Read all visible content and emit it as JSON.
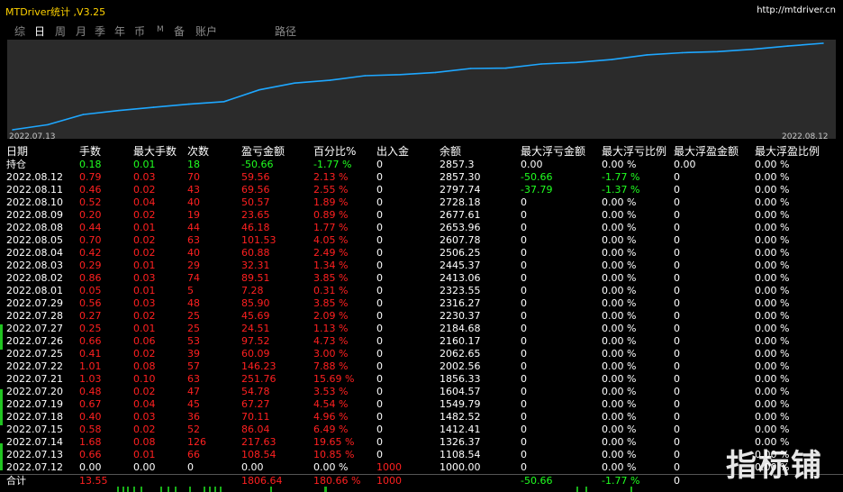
{
  "window": {
    "title": "MTDriver统计 ,V3.25",
    "url": "http://mtdriver.cn"
  },
  "tabs": [
    {
      "label": "综",
      "active": false
    },
    {
      "label": "日",
      "active": true
    },
    {
      "label": "周",
      "active": false
    },
    {
      "label": "月",
      "active": false
    },
    {
      "label": "季",
      "active": false
    },
    {
      "label": "年",
      "active": false
    },
    {
      "label": "币",
      "active": false
    },
    {
      "label": "M",
      "active": false
    },
    {
      "label": "备",
      "active": false
    },
    {
      "label": "账户",
      "active": false
    },
    {
      "label": "路径",
      "active": false
    }
  ],
  "chart_data": {
    "type": "line",
    "x_start_label": "2022.07.13",
    "x_end_label": "2022.08.12",
    "x": [
      "2022.07.12",
      "2022.07.13",
      "2022.07.14",
      "2022.07.15",
      "2022.07.18",
      "2022.07.19",
      "2022.07.20",
      "2022.07.21",
      "2022.07.22",
      "2022.07.25",
      "2022.07.26",
      "2022.07.27",
      "2022.07.28",
      "2022.07.29",
      "2022.08.01",
      "2022.08.02",
      "2022.08.03",
      "2022.08.04",
      "2022.08.05",
      "2022.08.08",
      "2022.08.09",
      "2022.08.10",
      "2022.08.11",
      "2022.08.12"
    ],
    "values": [
      1000.0,
      1108.54,
      1326.37,
      1412.41,
      1482.52,
      1549.79,
      1604.57,
      1856.33,
      2002.56,
      2062.65,
      2160.17,
      2184.68,
      2230.37,
      2316.27,
      2323.55,
      2413.06,
      2445.37,
      2506.25,
      2607.78,
      2653.96,
      2677.61,
      2728.18,
      2797.74,
      2857.3
    ],
    "color": "#1ea7ff",
    "background": "#2b2b2b"
  },
  "table": {
    "headers": [
      "日期",
      "手数",
      "最大手数",
      "次数",
      "盈亏金额",
      "百分比%",
      "出入金",
      "余额",
      "最大浮亏金额",
      "最大浮亏比例",
      "最大浮盈金额",
      "最大浮盈比例"
    ],
    "position_row": {
      "date": "持仓",
      "lots": "0.18",
      "max_lots": "0.01",
      "count": "18",
      "pnl": "-50.66",
      "pct": "-1.77 %",
      "deposit": "0",
      "balance": "2857.3",
      "max_float_loss": "0.00",
      "max_float_loss_pct": "0.00 %",
      "max_float_profit": "0.00",
      "max_float_profit_pct": "0.00 %"
    },
    "rows": [
      {
        "date": "2022.08.12",
        "lots": "0.79",
        "max_lots": "0.03",
        "count": "70",
        "pnl": "59.56",
        "pct": "2.13 %",
        "deposit": "0",
        "balance": "2857.30",
        "max_float_loss": "-50.66",
        "max_float_loss_pct": "-1.77 %",
        "max_float_profit": "0",
        "max_float_profit_pct": "0.00 %"
      },
      {
        "date": "2022.08.11",
        "lots": "0.46",
        "max_lots": "0.02",
        "count": "43",
        "pnl": "69.56",
        "pct": "2.55 %",
        "deposit": "0",
        "balance": "2797.74",
        "max_float_loss": "-37.79",
        "max_float_loss_pct": "-1.37 %",
        "max_float_profit": "0",
        "max_float_profit_pct": "0.00 %"
      },
      {
        "date": "2022.08.10",
        "lots": "0.52",
        "max_lots": "0.04",
        "count": "40",
        "pnl": "50.57",
        "pct": "1.89 %",
        "deposit": "0",
        "balance": "2728.18",
        "max_float_loss": "0",
        "max_float_loss_pct": "0.00 %",
        "max_float_profit": "0",
        "max_float_profit_pct": "0.00 %"
      },
      {
        "date": "2022.08.09",
        "lots": "0.20",
        "max_lots": "0.02",
        "count": "19",
        "pnl": "23.65",
        "pct": "0.89 %",
        "deposit": "0",
        "balance": "2677.61",
        "max_float_loss": "0",
        "max_float_loss_pct": "0.00 %",
        "max_float_profit": "0",
        "max_float_profit_pct": "0.00 %"
      },
      {
        "date": "2022.08.08",
        "lots": "0.44",
        "max_lots": "0.01",
        "count": "44",
        "pnl": "46.18",
        "pct": "1.77 %",
        "deposit": "0",
        "balance": "2653.96",
        "max_float_loss": "0",
        "max_float_loss_pct": "0.00 %",
        "max_float_profit": "0",
        "max_float_profit_pct": "0.00 %"
      },
      {
        "date": "2022.08.05",
        "lots": "0.70",
        "max_lots": "0.02",
        "count": "63",
        "pnl": "101.53",
        "pct": "4.05 %",
        "deposit": "0",
        "balance": "2607.78",
        "max_float_loss": "0",
        "max_float_loss_pct": "0.00 %",
        "max_float_profit": "0",
        "max_float_profit_pct": "0.00 %"
      },
      {
        "date": "2022.08.04",
        "lots": "0.42",
        "max_lots": "0.02",
        "count": "40",
        "pnl": "60.88",
        "pct": "2.49 %",
        "deposit": "0",
        "balance": "2506.25",
        "max_float_loss": "0",
        "max_float_loss_pct": "0.00 %",
        "max_float_profit": "0",
        "max_float_profit_pct": "0.00 %"
      },
      {
        "date": "2022.08.03",
        "lots": "0.29",
        "max_lots": "0.01",
        "count": "29",
        "pnl": "32.31",
        "pct": "1.34 %",
        "deposit": "0",
        "balance": "2445.37",
        "max_float_loss": "0",
        "max_float_loss_pct": "0.00 %",
        "max_float_profit": "0",
        "max_float_profit_pct": "0.00 %"
      },
      {
        "date": "2022.08.02",
        "lots": "0.86",
        "max_lots": "0.03",
        "count": "74",
        "pnl": "89.51",
        "pct": "3.85 %",
        "deposit": "0",
        "balance": "2413.06",
        "max_float_loss": "0",
        "max_float_loss_pct": "0.00 %",
        "max_float_profit": "0",
        "max_float_profit_pct": "0.00 %"
      },
      {
        "date": "2022.08.01",
        "lots": "0.05",
        "max_lots": "0.01",
        "count": "5",
        "pnl": "7.28",
        "pct": "0.31 %",
        "deposit": "0",
        "balance": "2323.55",
        "max_float_loss": "0",
        "max_float_loss_pct": "0.00 %",
        "max_float_profit": "0",
        "max_float_profit_pct": "0.00 %"
      },
      {
        "date": "2022.07.29",
        "lots": "0.56",
        "max_lots": "0.03",
        "count": "48",
        "pnl": "85.90",
        "pct": "3.85 %",
        "deposit": "0",
        "balance": "2316.27",
        "max_float_loss": "0",
        "max_float_loss_pct": "0.00 %",
        "max_float_profit": "0",
        "max_float_profit_pct": "0.00 %"
      },
      {
        "date": "2022.07.28",
        "lots": "0.27",
        "max_lots": "0.02",
        "count": "25",
        "pnl": "45.69",
        "pct": "2.09 %",
        "deposit": "0",
        "balance": "2230.37",
        "max_float_loss": "0",
        "max_float_loss_pct": "0.00 %",
        "max_float_profit": "0",
        "max_float_profit_pct": "0.00 %"
      },
      {
        "date": "2022.07.27",
        "lots": "0.25",
        "max_lots": "0.01",
        "count": "25",
        "pnl": "24.51",
        "pct": "1.13 %",
        "deposit": "0",
        "balance": "2184.68",
        "max_float_loss": "0",
        "max_float_loss_pct": "0.00 %",
        "max_float_profit": "0",
        "max_float_profit_pct": "0.00 %"
      },
      {
        "date": "2022.07.26",
        "lots": "0.66",
        "max_lots": "0.06",
        "count": "53",
        "pnl": "97.52",
        "pct": "4.73 %",
        "deposit": "0",
        "balance": "2160.17",
        "max_float_loss": "0",
        "max_float_loss_pct": "0.00 %",
        "max_float_profit": "0",
        "max_float_profit_pct": "0.00 %"
      },
      {
        "date": "2022.07.25",
        "lots": "0.41",
        "max_lots": "0.02",
        "count": "39",
        "pnl": "60.09",
        "pct": "3.00 %",
        "deposit": "0",
        "balance": "2062.65",
        "max_float_loss": "0",
        "max_float_loss_pct": "0.00 %",
        "max_float_profit": "0",
        "max_float_profit_pct": "0.00 %"
      },
      {
        "date": "2022.07.22",
        "lots": "1.01",
        "max_lots": "0.08",
        "count": "57",
        "pnl": "146.23",
        "pct": "7.88 %",
        "deposit": "0",
        "balance": "2002.56",
        "max_float_loss": "0",
        "max_float_loss_pct": "0.00 %",
        "max_float_profit": "0",
        "max_float_profit_pct": "0.00 %"
      },
      {
        "date": "2022.07.21",
        "lots": "1.03",
        "max_lots": "0.10",
        "count": "63",
        "pnl": "251.76",
        "pct": "15.69 %",
        "deposit": "0",
        "balance": "1856.33",
        "max_float_loss": "0",
        "max_float_loss_pct": "0.00 %",
        "max_float_profit": "0",
        "max_float_profit_pct": "0.00 %"
      },
      {
        "date": "2022.07.20",
        "lots": "0.48",
        "max_lots": "0.02",
        "count": "47",
        "pnl": "54.78",
        "pct": "3.53 %",
        "deposit": "0",
        "balance": "1604.57",
        "max_float_loss": "0",
        "max_float_loss_pct": "0.00 %",
        "max_float_profit": "0",
        "max_float_profit_pct": "0.00 %"
      },
      {
        "date": "2022.07.19",
        "lots": "0.67",
        "max_lots": "0.04",
        "count": "45",
        "pnl": "67.27",
        "pct": "4.54 %",
        "deposit": "0",
        "balance": "1549.79",
        "max_float_loss": "0",
        "max_float_loss_pct": "0.00 %",
        "max_float_profit": "0",
        "max_float_profit_pct": "0.00 %"
      },
      {
        "date": "2022.07.18",
        "lots": "0.40",
        "max_lots": "0.03",
        "count": "36",
        "pnl": "70.11",
        "pct": "4.96 %",
        "deposit": "0",
        "balance": "1482.52",
        "max_float_loss": "0",
        "max_float_loss_pct": "0.00 %",
        "max_float_profit": "0",
        "max_float_profit_pct": "0.00 %"
      },
      {
        "date": "2022.07.15",
        "lots": "0.58",
        "max_lots": "0.02",
        "count": "52",
        "pnl": "86.04",
        "pct": "6.49 %",
        "deposit": "0",
        "balance": "1412.41",
        "max_float_loss": "0",
        "max_float_loss_pct": "0.00 %",
        "max_float_profit": "0",
        "max_float_profit_pct": "0.00 %"
      },
      {
        "date": "2022.07.14",
        "lots": "1.68",
        "max_lots": "0.08",
        "count": "126",
        "pnl": "217.63",
        "pct": "19.65 %",
        "deposit": "0",
        "balance": "1326.37",
        "max_float_loss": "0",
        "max_float_loss_pct": "0.00 %",
        "max_float_profit": "0",
        "max_float_profit_pct": "0.00 %"
      },
      {
        "date": "2022.07.13",
        "lots": "0.66",
        "max_lots": "0.01",
        "count": "66",
        "pnl": "108.54",
        "pct": "10.85 %",
        "deposit": "0",
        "balance": "1108.54",
        "max_float_loss": "0",
        "max_float_loss_pct": "0.00 %",
        "max_float_profit": "0",
        "max_float_profit_pct": "0.00 %"
      },
      {
        "date": "2022.07.12",
        "lots": "0.00",
        "max_lots": "0.00",
        "count": "0",
        "pnl": "0.00",
        "pct": "0.00 %",
        "deposit": "1000",
        "balance": "1000.00",
        "max_float_loss": "0",
        "max_float_loss_pct": "0.00 %",
        "max_float_profit": "0",
        "max_float_profit_pct": "0.00 %"
      }
    ],
    "total_row": {
      "label": "合计",
      "lots": "13.55",
      "pnl": "1806.64",
      "pct": "180.66 %",
      "deposit": "1000",
      "max_float_loss": "-50.66",
      "max_float_loss_pct": "-1.77 %",
      "max_float_profit": "0"
    }
  },
  "watermark": "指标铺",
  "colors": {
    "profit": "#ff2020",
    "loss": "#20ff20",
    "title": "#ffd200",
    "line": "#1ea7ff"
  }
}
